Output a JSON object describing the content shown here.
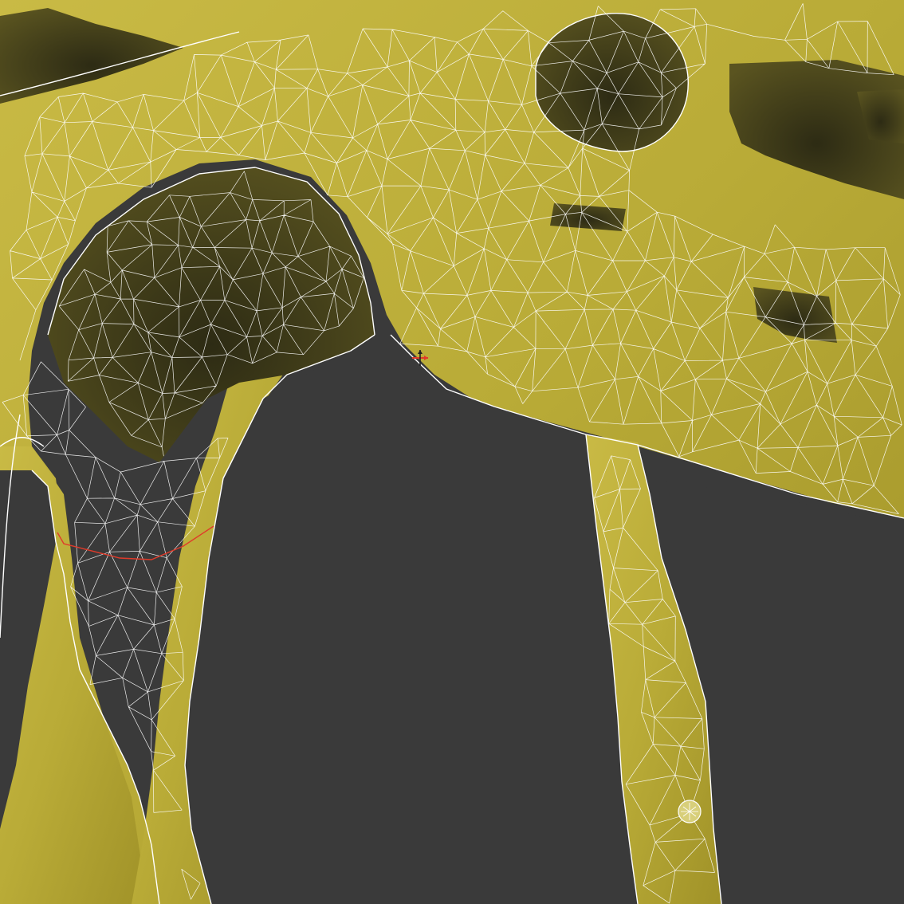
{
  "viewport": {
    "background_color": "#3a3a3a",
    "mesh_color": "#b9ab37",
    "mesh_shadow_color": "#4e4a16",
    "wireframe_color": "#ffffff",
    "selection_color": "#e03a2a"
  },
  "icons": {
    "pivot_gizmo": "move-gizmo-icon",
    "selection_outline": "edge-selection-icon"
  }
}
